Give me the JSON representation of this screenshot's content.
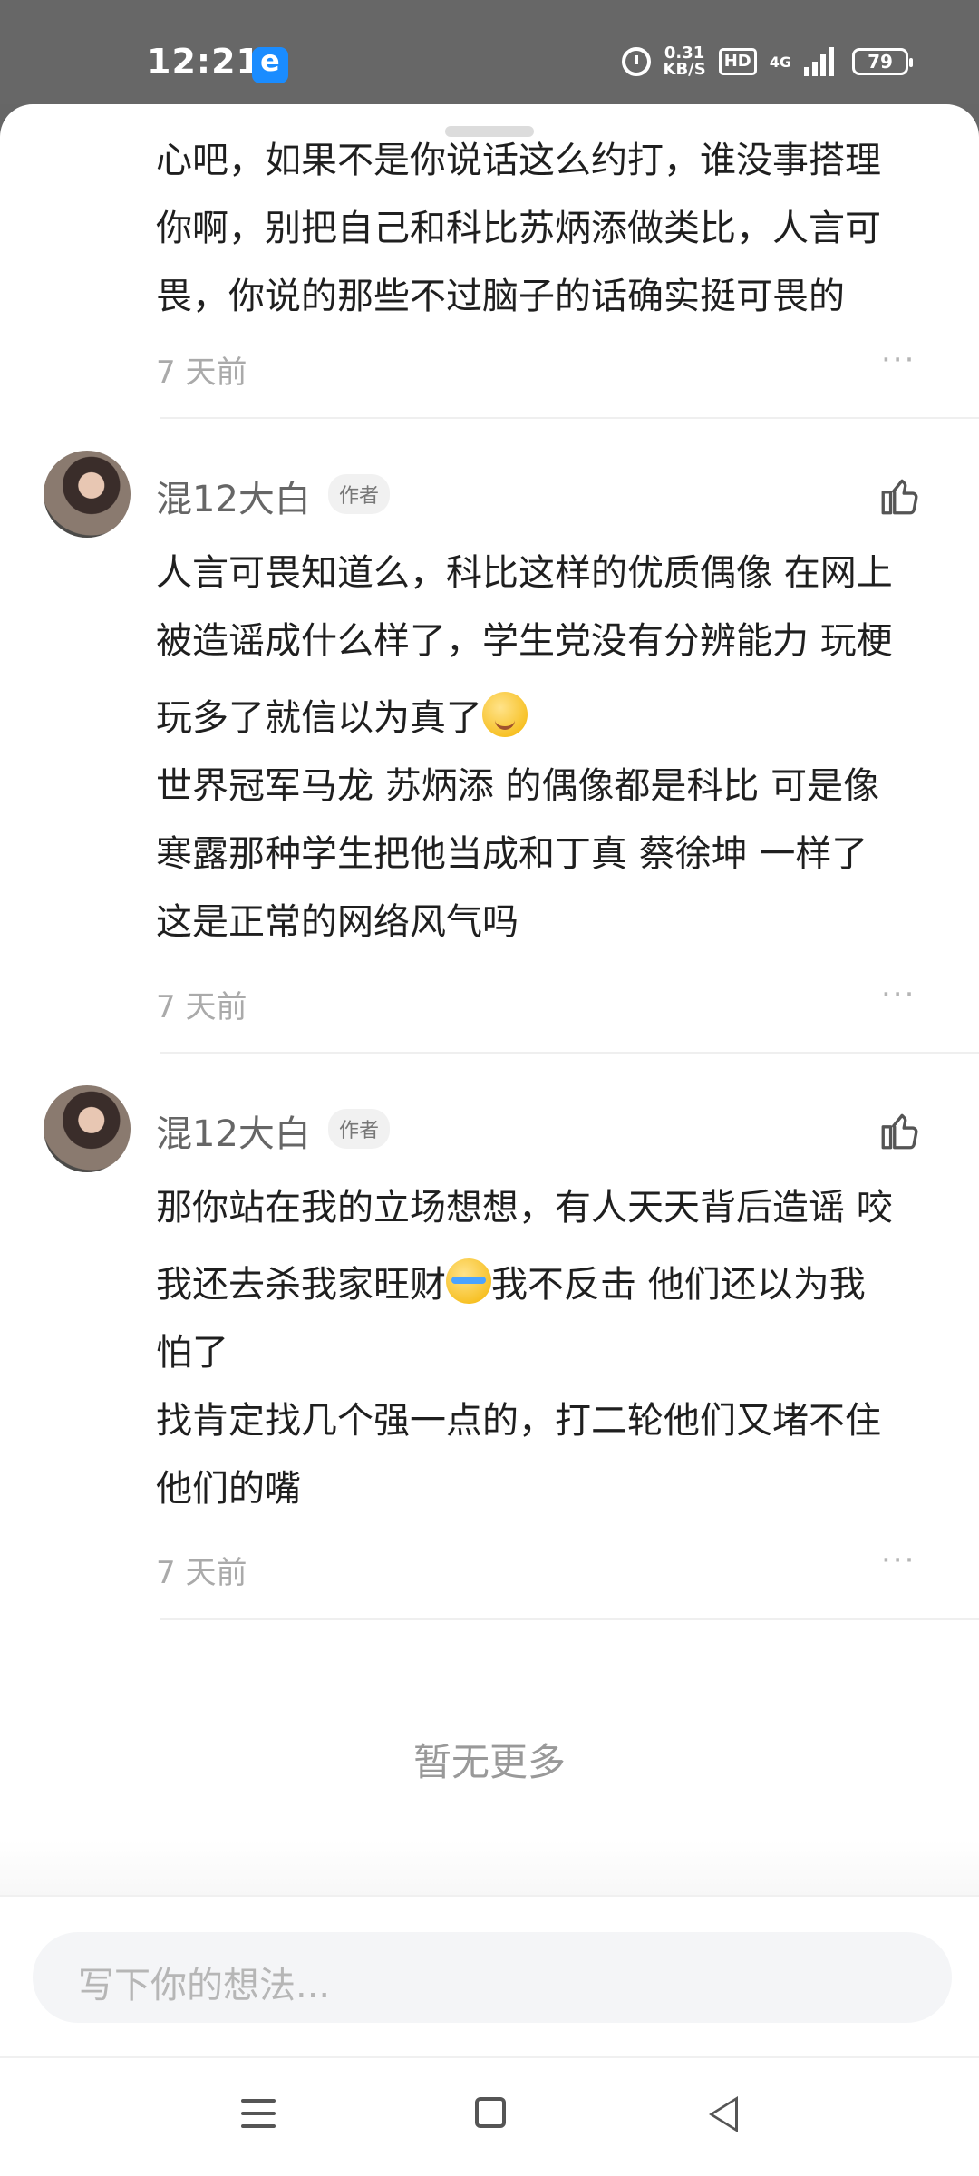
{
  "status_bar": {
    "time": "12:21",
    "net_speed_value": "0.31",
    "net_speed_unit": "KB/S",
    "hd_label": "HD",
    "network_label": "4G",
    "battery": "79"
  },
  "comments": [
    {
      "text_lines": [
        "心吧，如果不是你说话这么约打，谁没事搭理",
        "你啊，别把自己和科比苏炳添做类比，人言可",
        "畏，你说的那些不过脑子的话确实挺可畏的"
      ],
      "time": "7 天前",
      "more": "···"
    },
    {
      "username": "混12大白",
      "author_tag": "作者",
      "line1": "人言可畏知道么，科比这样的优质偶像 在网上",
      "line2": "被造谣成什么样了，学生党没有分辨能力 玩梗",
      "line3": "玩多了就信以为真了",
      "line4": "世界冠军马龙 苏炳添 的偶像都是科比 可是像",
      "line5": "寒露那种学生把他当成和丁真 蔡徐坤 一样了",
      "line6": "这是正常的网络风气吗",
      "time": "7 天前",
      "more": "···"
    },
    {
      "username": "混12大白",
      "author_tag": "作者",
      "line1": "那你站在我的立场想想，有人天天背后造谣 咬",
      "line2a": "我还去杀我家旺财",
      "line2b": "我不反击 他们还以为我",
      "line3": "怕了",
      "line4": "找肯定找几个强一点的，打二轮他们又堵不住",
      "line5": "他们的嘴",
      "time": "7 天前",
      "more": "···"
    }
  ],
  "no_more_text": "暂无更多",
  "input": {
    "placeholder": "写下你的想法..."
  },
  "icons": {
    "like": "thumbs-up-icon",
    "more": "more-dots-icon",
    "nav_menu": "menu-icon",
    "nav_home": "home-icon",
    "nav_back": "back-icon"
  }
}
